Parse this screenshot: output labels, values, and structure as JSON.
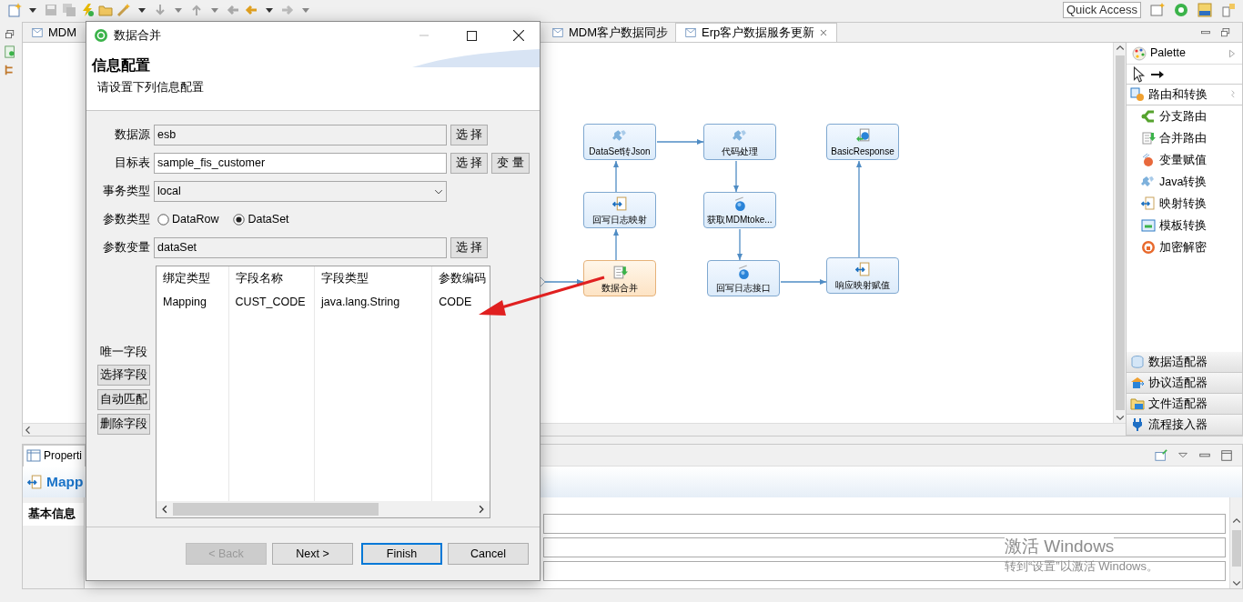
{
  "toolbar": {
    "quick_access": "Quick Access"
  },
  "editor_tabs": [
    {
      "label": "MDM",
      "selected": false,
      "closable": false
    },
    {
      "label": "MDM客户数据同步",
      "selected": false,
      "closable": false
    },
    {
      "label": "Erp客户数据服务更新",
      "selected": true,
      "closable": true
    }
  ],
  "diagram": {
    "nodes": [
      {
        "label": "DataSet转Json",
        "kind": "java",
        "selected": false
      },
      {
        "label": "代码处理",
        "kind": "java",
        "selected": false
      },
      {
        "label": "BasicResponse",
        "kind": "response",
        "selected": false
      },
      {
        "label": "回写日志映射",
        "kind": "mapping",
        "selected": false
      },
      {
        "label": "获取MDMtoke...",
        "kind": "service",
        "selected": false
      },
      {
        "label": "数据合并",
        "kind": "merge",
        "selected": true
      },
      {
        "label": "回写日志接口",
        "kind": "service",
        "selected": false
      },
      {
        "label": "响应映射赋值",
        "kind": "mapping",
        "selected": false
      }
    ]
  },
  "palette": {
    "title": "Palette",
    "drawers": [
      {
        "label": "路由和转换",
        "kind": "route",
        "expanded": true,
        "items": [
          {
            "label": "分支路由",
            "kind": "branch"
          },
          {
            "label": "合并路由",
            "kind": "merge"
          },
          {
            "label": "变量赋值",
            "kind": "variable"
          },
          {
            "label": "Java转换",
            "kind": "java"
          },
          {
            "label": "映射转换",
            "kind": "mapping"
          },
          {
            "label": "模板转换",
            "kind": "template"
          },
          {
            "label": "加密解密",
            "kind": "crypto"
          }
        ]
      },
      {
        "label": "数据适配器",
        "kind": "data",
        "expanded": false
      },
      {
        "label": "协议适配器",
        "kind": "protocol",
        "expanded": false
      },
      {
        "label": "文件适配器",
        "kind": "file",
        "expanded": false
      },
      {
        "label": "流程接入器",
        "kind": "plug",
        "expanded": false
      }
    ]
  },
  "properties": {
    "tab": "Properti",
    "title": "Mapp",
    "sections": [
      {
        "label": "基本信息",
        "selected": true
      }
    ]
  },
  "dialog": {
    "title": "数据合并",
    "header_title": "信息配置",
    "header_message": "请设置下列信息配置",
    "fields": [
      {
        "kind": "text",
        "label": "数据源",
        "value": "esb",
        "buttons": [
          "选 择"
        ]
      },
      {
        "kind": "text",
        "label": "目标表",
        "value": "sample_fis_customer",
        "buttons": [
          "选 择",
          "变 量"
        ]
      },
      {
        "kind": "select",
        "label": "事务类型",
        "value": "local"
      },
      {
        "kind": "radio",
        "label": "参数类型",
        "options": [
          {
            "label": "DataRow",
            "selected": false
          },
          {
            "label": "DataSet",
            "selected": true
          }
        ]
      },
      {
        "kind": "text",
        "label": "参数变量",
        "value": "dataSet",
        "buttons": [
          "选 择"
        ]
      }
    ],
    "unique_label": "唯一字段",
    "side_buttons": [
      "选择字段",
      "自动匹配",
      "删除字段"
    ],
    "table": {
      "columns": [
        "绑定类型",
        "字段名称",
        "字段类型",
        "参数编码"
      ],
      "rows": [
        [
          "Mapping",
          "CUST_CODE",
          "java.lang.String",
          "CODE"
        ]
      ]
    },
    "buttons": [
      {
        "label": "< Back",
        "disabled": true,
        "default": false
      },
      {
        "label": "Next >",
        "disabled": false,
        "default": false
      },
      {
        "label": "Finish",
        "disabled": false,
        "default": true
      },
      {
        "label": "Cancel",
        "disabled": false,
        "default": false
      }
    ]
  },
  "activation": {
    "title": "激活 Windows",
    "message": "转到“设置”以激活 Windows。"
  }
}
